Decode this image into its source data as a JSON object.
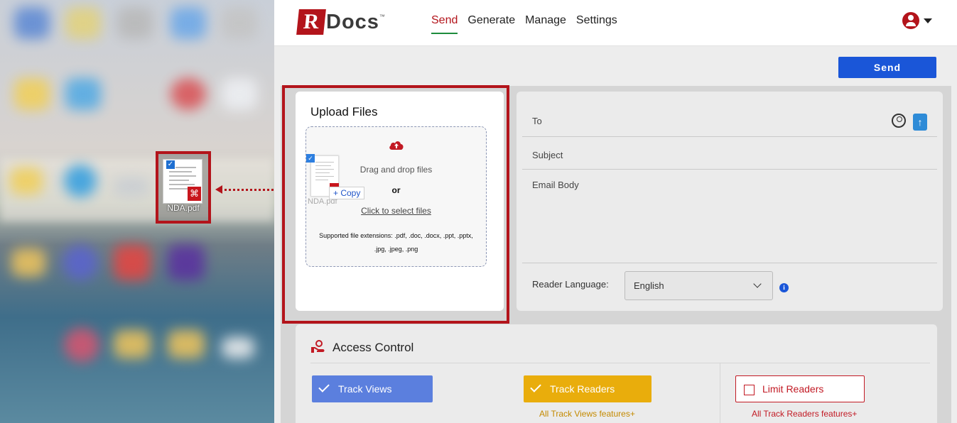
{
  "desktop": {
    "file_label": "NDA.pdf"
  },
  "header": {
    "logo_r": "R",
    "logo_rest": "Docs",
    "logo_tm": "™",
    "nav": [
      {
        "label": "Send",
        "active": true
      },
      {
        "label": "Generate",
        "active": false
      },
      {
        "label": "Manage",
        "active": false
      },
      {
        "label": "Settings",
        "active": false
      }
    ]
  },
  "toolbar": {
    "send_label": "Send"
  },
  "upload": {
    "title": "Upload Files",
    "drag_text": "Drag and drop files",
    "or_text": "or",
    "select_link": "Click to select files",
    "extensions": "Supported file extensions: .pdf, .doc, .docx, .ppt, .pptx, .jpg, .jpeg, .png",
    "ghost_label": "NDA.pdf",
    "copy_label": "+ Copy"
  },
  "email": {
    "to_label": "To",
    "subject_label": "Subject",
    "body_label": "Email Body",
    "language_label": "Reader Language:",
    "language_value": "English"
  },
  "access": {
    "title": "Access Control",
    "options": [
      {
        "label": "Track Views",
        "checked": true,
        "subtext": ""
      },
      {
        "label": "Track Readers",
        "checked": true,
        "subtext": "All Track Views features+"
      },
      {
        "label": "Limit Readers",
        "checked": false,
        "subtext": "All Track Readers features+"
      }
    ]
  },
  "colors": {
    "brand_red": "#b3141b",
    "primary_blue": "#1a56d8",
    "track_views": "#5b7fde",
    "track_readers": "#e9ad0c",
    "limit_readers": "#c21a24",
    "nav_active_underline": "#1e8c3c"
  },
  "icons": [
    "user-icon",
    "chevron-down-icon",
    "cloud-upload-icon",
    "contact-icon",
    "upload-icon",
    "info-icon",
    "access-control-icon",
    "pdf-icon",
    "check-icon"
  ]
}
